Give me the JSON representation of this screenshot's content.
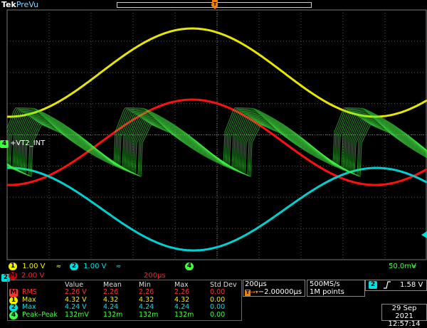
{
  "header": {
    "brand": "Tek",
    "state": "PreVu"
  },
  "channel_ref_label": "+VT2_INT",
  "markers": {
    "ground_left": "4",
    "ch2_side": "2"
  },
  "status_bar": {
    "ch1": {
      "num": "1",
      "scale": "1.00 V",
      "color": "#f0f000"
    },
    "ch2": {
      "num": "2",
      "scale": "1.00 V",
      "color": "#00e0e0"
    },
    "ch4": {
      "num": "4",
      "scale": "50.0mV",
      "color": "#40ff40"
    },
    "bw_icon": "bandwidth-limit-icon"
  },
  "math_row": {
    "label": "M",
    "scale": "2.00 V",
    "time": "200µs",
    "color": "#ff2020"
  },
  "measurements": {
    "headers": [
      "Value",
      "Mean",
      "Min",
      "Max",
      "Std Dev"
    ],
    "rows": [
      {
        "src": "M",
        "name": "RMS",
        "color": "#ff3030",
        "values": [
          "2.26 V",
          "2.26",
          "2.26",
          "2.26",
          "0.00"
        ]
      },
      {
        "src": "1",
        "name": "Max",
        "color": "#f0f000",
        "values": [
          "4.32 V",
          "4.32",
          "4.32",
          "4.32",
          "0.00"
        ]
      },
      {
        "src": "2",
        "name": "Max",
        "color": "#00e0e0",
        "values": [
          "4.24 V",
          "4.24",
          "4.24",
          "4.24",
          "0.00"
        ]
      },
      {
        "src": "4",
        "name": "Peak–Peak",
        "color": "#40ff40",
        "values": [
          "132mV",
          "132m",
          "132m",
          "132m",
          "0.00"
        ]
      }
    ]
  },
  "timebase": {
    "scale": "200µs",
    "delay": "−2.00000µs",
    "trigger_symbol": "T"
  },
  "acquisition": {
    "rate": "500MS/s",
    "length": "1M points"
  },
  "trigger": {
    "source": "2",
    "level": "1.58 V"
  },
  "datetime": {
    "date": "29 Sep  2021",
    "time": "12:57:14"
  }
}
